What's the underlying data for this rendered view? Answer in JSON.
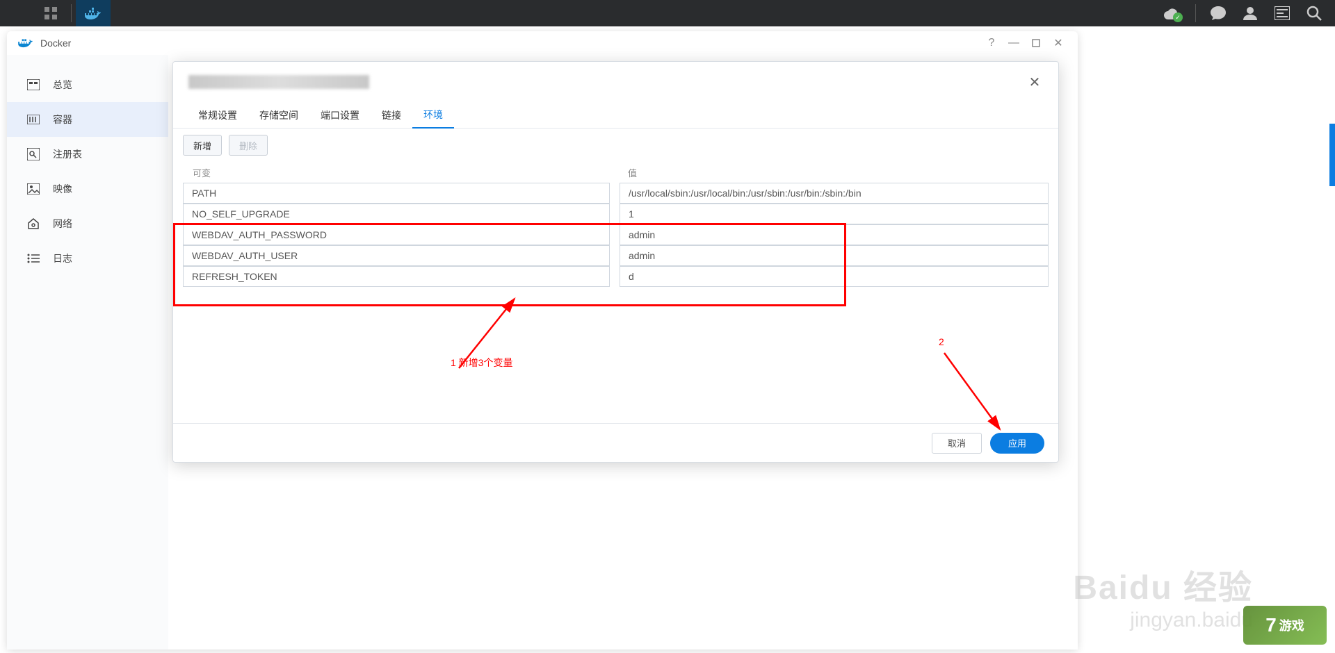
{
  "topbar": {
    "cloud_status": "ok"
  },
  "window": {
    "title": "Docker"
  },
  "sidebar": {
    "items": [
      {
        "label": "总览"
      },
      {
        "label": "容器"
      },
      {
        "label": "注册表"
      },
      {
        "label": "映像"
      },
      {
        "label": "网络"
      },
      {
        "label": "日志"
      }
    ]
  },
  "modal": {
    "tabs": [
      "常规设置",
      "存储空间",
      "端口设置",
      "链接",
      "环境"
    ],
    "active_tab": "环境",
    "toolbar": {
      "add": "新增",
      "delete": "删除"
    },
    "columns": {
      "var": "可变",
      "val": "值"
    },
    "rows": [
      {
        "var": "PATH",
        "val": "/usr/local/sbin:/usr/local/bin:/usr/sbin:/usr/bin:/sbin:/bin"
      },
      {
        "var": "NO_SELF_UPGRADE",
        "val": "1"
      },
      {
        "var": "WEBDAV_AUTH_PASSWORD",
        "val": "admin"
      },
      {
        "var": "WEBDAV_AUTH_USER",
        "val": "admin"
      },
      {
        "var": "REFRESH_TOKEN",
        "val": "d"
      }
    ],
    "buttons": {
      "cancel": "取消",
      "apply": "应用"
    }
  },
  "annotations": {
    "a1": "1 新增3个变量",
    "a2": "2"
  },
  "watermark": {
    "line1": "Baidu 经验",
    "line2": "jingyan.baidu"
  },
  "logo7": {
    "num": "7",
    "text": "游戏"
  }
}
